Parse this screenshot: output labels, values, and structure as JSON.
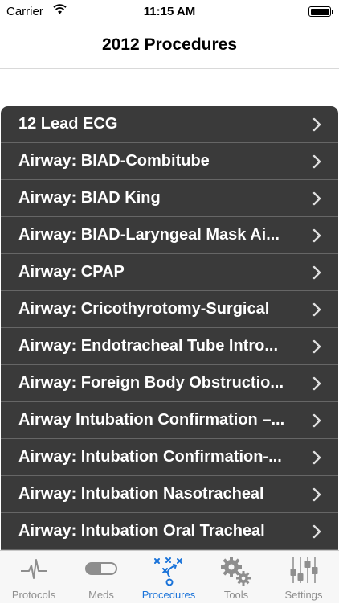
{
  "status": {
    "carrier": "Carrier",
    "time": "11:15 AM"
  },
  "nav": {
    "title": "2012 Procedures"
  },
  "procedures": [
    "12 Lead ECG",
    "Airway: BIAD-Combitube",
    "Airway: BIAD King",
    "Airway: BIAD-Laryngeal Mask Ai...",
    "Airway: CPAP",
    "Airway: Cricothyrotomy-Surgical",
    "Airway: Endotracheal Tube Intro...",
    "Airway: Foreign Body Obstructio...",
    "Airway Intubation Confirmation –...",
    "Airway: Intubation Confirmation-...",
    "Airway: Intubation Nasotracheal",
    "Airway: Intubation Oral Tracheal"
  ],
  "tabs": [
    {
      "label": "Protocols",
      "icon": "waveform-icon"
    },
    {
      "label": "Meds",
      "icon": "pill-icon"
    },
    {
      "label": "Procedures",
      "icon": "play-diagram-icon",
      "active": true
    },
    {
      "label": "Tools",
      "icon": "gears-icon"
    },
    {
      "label": "Settings",
      "icon": "sliders-icon"
    }
  ],
  "colors": {
    "accent": "#1a73d9",
    "list_bg": "#3a3a3a",
    "tab_inactive": "#8e8e8e"
  }
}
